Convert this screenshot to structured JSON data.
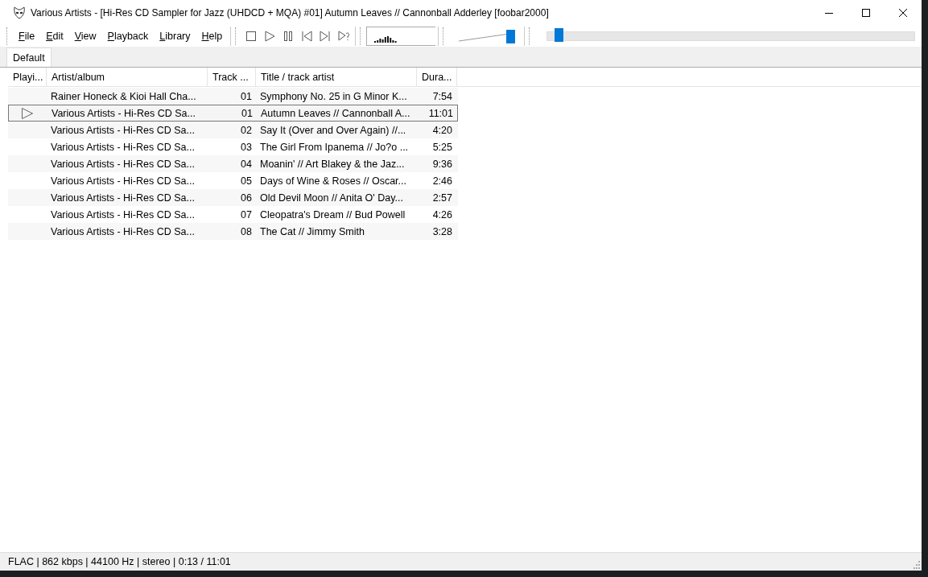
{
  "window": {
    "title": "Various Artists - [Hi-Res CD Sampler for Jazz (UHDCD + MQA) #01] Autumn Leaves // Cannonball Adderley  [foobar2000]"
  },
  "menu": [
    "File",
    "Edit",
    "View",
    "Playback",
    "Library",
    "Help"
  ],
  "volume": {
    "level": 1.0
  },
  "seek": {
    "level": 0.02
  },
  "tabs": [
    {
      "label": "Default",
      "selected": true
    }
  ],
  "table": {
    "columns": [
      "Playi...",
      "Artist/album",
      "Track ...",
      "Title / track artist",
      "Dura..."
    ],
    "rows": [
      {
        "artist": "Rainer Honeck & Kioi Hall Cha...",
        "track": "01",
        "title": "Symphony No. 25 in G Minor K...",
        "duration": "7:54",
        "playing": false,
        "selected": false
      },
      {
        "artist": "Various Artists - Hi-Res CD Sa...",
        "track": "01",
        "title": "Autumn Leaves // Cannonball A...",
        "duration": "11:01",
        "playing": true,
        "selected": true
      },
      {
        "artist": "Various Artists - Hi-Res CD Sa...",
        "track": "02",
        "title": "Say It (Over and Over Again) //...",
        "duration": "4:20",
        "playing": false,
        "selected": false
      },
      {
        "artist": "Various Artists - Hi-Res CD Sa...",
        "track": "03",
        "title": "The Girl From Ipanema // Jo?o ...",
        "duration": "5:25",
        "playing": false,
        "selected": false
      },
      {
        "artist": "Various Artists - Hi-Res CD Sa...",
        "track": "04",
        "title": "Moanin' // Art Blakey & the Jaz...",
        "duration": "9:36",
        "playing": false,
        "selected": false
      },
      {
        "artist": "Various Artists - Hi-Res CD Sa...",
        "track": "05",
        "title": "Days of Wine & Roses // Oscar...",
        "duration": "2:46",
        "playing": false,
        "selected": false
      },
      {
        "artist": "Various Artists - Hi-Res CD Sa...",
        "track": "06",
        "title": "Old Devil Moon // Anita O' Day...",
        "duration": "2:57",
        "playing": false,
        "selected": false
      },
      {
        "artist": "Various Artists - Hi-Res CD Sa...",
        "track": "07",
        "title": "Cleopatra's Dream // Bud Powell",
        "duration": "4:26",
        "playing": false,
        "selected": false
      },
      {
        "artist": "Various Artists - Hi-Res CD Sa...",
        "track": "08",
        "title": "The Cat // Jimmy Smith",
        "duration": "3:28",
        "playing": false,
        "selected": false
      }
    ]
  },
  "status_bar": "FLAC | 862 kbps | 44100 Hz | stereo | 0:13 / 11:01"
}
